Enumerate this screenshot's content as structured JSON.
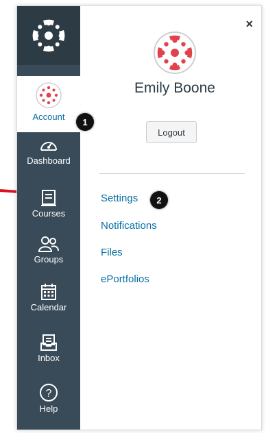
{
  "colors": {
    "sidebar": "#394b58",
    "logo_block": "#2d3b45",
    "link": "#0770a3",
    "brand_red": "#e0434d",
    "arrow": "#d9141e"
  },
  "sidebar": {
    "items": [
      {
        "label": "Account",
        "icon": "account-avatar-icon"
      },
      {
        "label": "Dashboard",
        "icon": "dashboard-icon"
      },
      {
        "label": "Courses",
        "icon": "courses-icon"
      },
      {
        "label": "Groups",
        "icon": "groups-icon"
      },
      {
        "label": "Calendar",
        "icon": "calendar-icon"
      },
      {
        "label": "Inbox",
        "icon": "inbox-icon"
      },
      {
        "label": "Help",
        "icon": "help-icon"
      }
    ]
  },
  "tray": {
    "user_name": "Emily Boone",
    "logout_label": "Logout",
    "close_symbol": "×",
    "links": [
      "Settings",
      "Notifications",
      "Files",
      "ePortfolios"
    ]
  },
  "callouts": {
    "first": "1",
    "second": "2"
  }
}
